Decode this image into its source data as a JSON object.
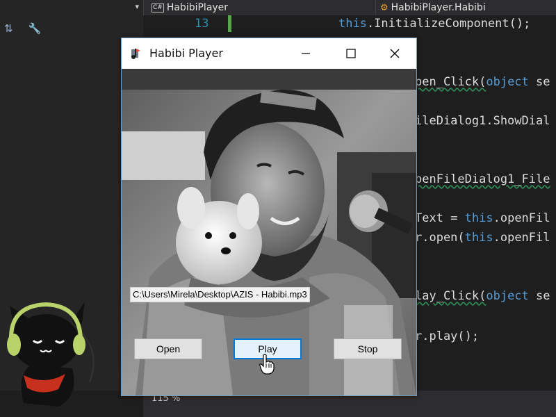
{
  "ide": {
    "left_tab_chevron": "▾",
    "file_tab": {
      "badge": "C#",
      "label": "HabibiPlayer"
    },
    "class_tab": {
      "label": "HabibiPlayer.Habibi"
    },
    "line_number": "13",
    "code_lines": [
      {
        "pre": "",
        "kw": "this",
        "post": ".InitializeComponent();"
      },
      {
        "pre": "pen_Click(",
        "kw": "object",
        "post": " se"
      },
      {
        "pre": "ileDialog1.ShowDial",
        "kw": "",
        "post": ""
      },
      {
        "pre": "penFileDialog1_File",
        "kw": "",
        "post": ""
      },
      {
        "pre": "Text = ",
        "kw": "this",
        "post": ".openFil"
      },
      {
        "pre": "r.open(",
        "kw": "this",
        "post": ".openFil"
      },
      {
        "pre": "lay_Click(",
        "kw": "object",
        "post": " se"
      },
      {
        "pre": "r.play();",
        "kw": "",
        "post": ""
      }
    ],
    "zoom": "115 %"
  },
  "window": {
    "title": "Habibi Player",
    "minimize": "minimize",
    "maximize": "maximize",
    "close": "close",
    "file_path": "C:\\Users\\Mirela\\Desktop\\AZIS - Habibi.mp3",
    "buttons": {
      "open": "Open",
      "play": "Play",
      "stop": "Stop"
    }
  },
  "colors": {
    "keyword": "#569cd6",
    "accent": "#0078d7",
    "code_text": "#dcdcdc"
  }
}
